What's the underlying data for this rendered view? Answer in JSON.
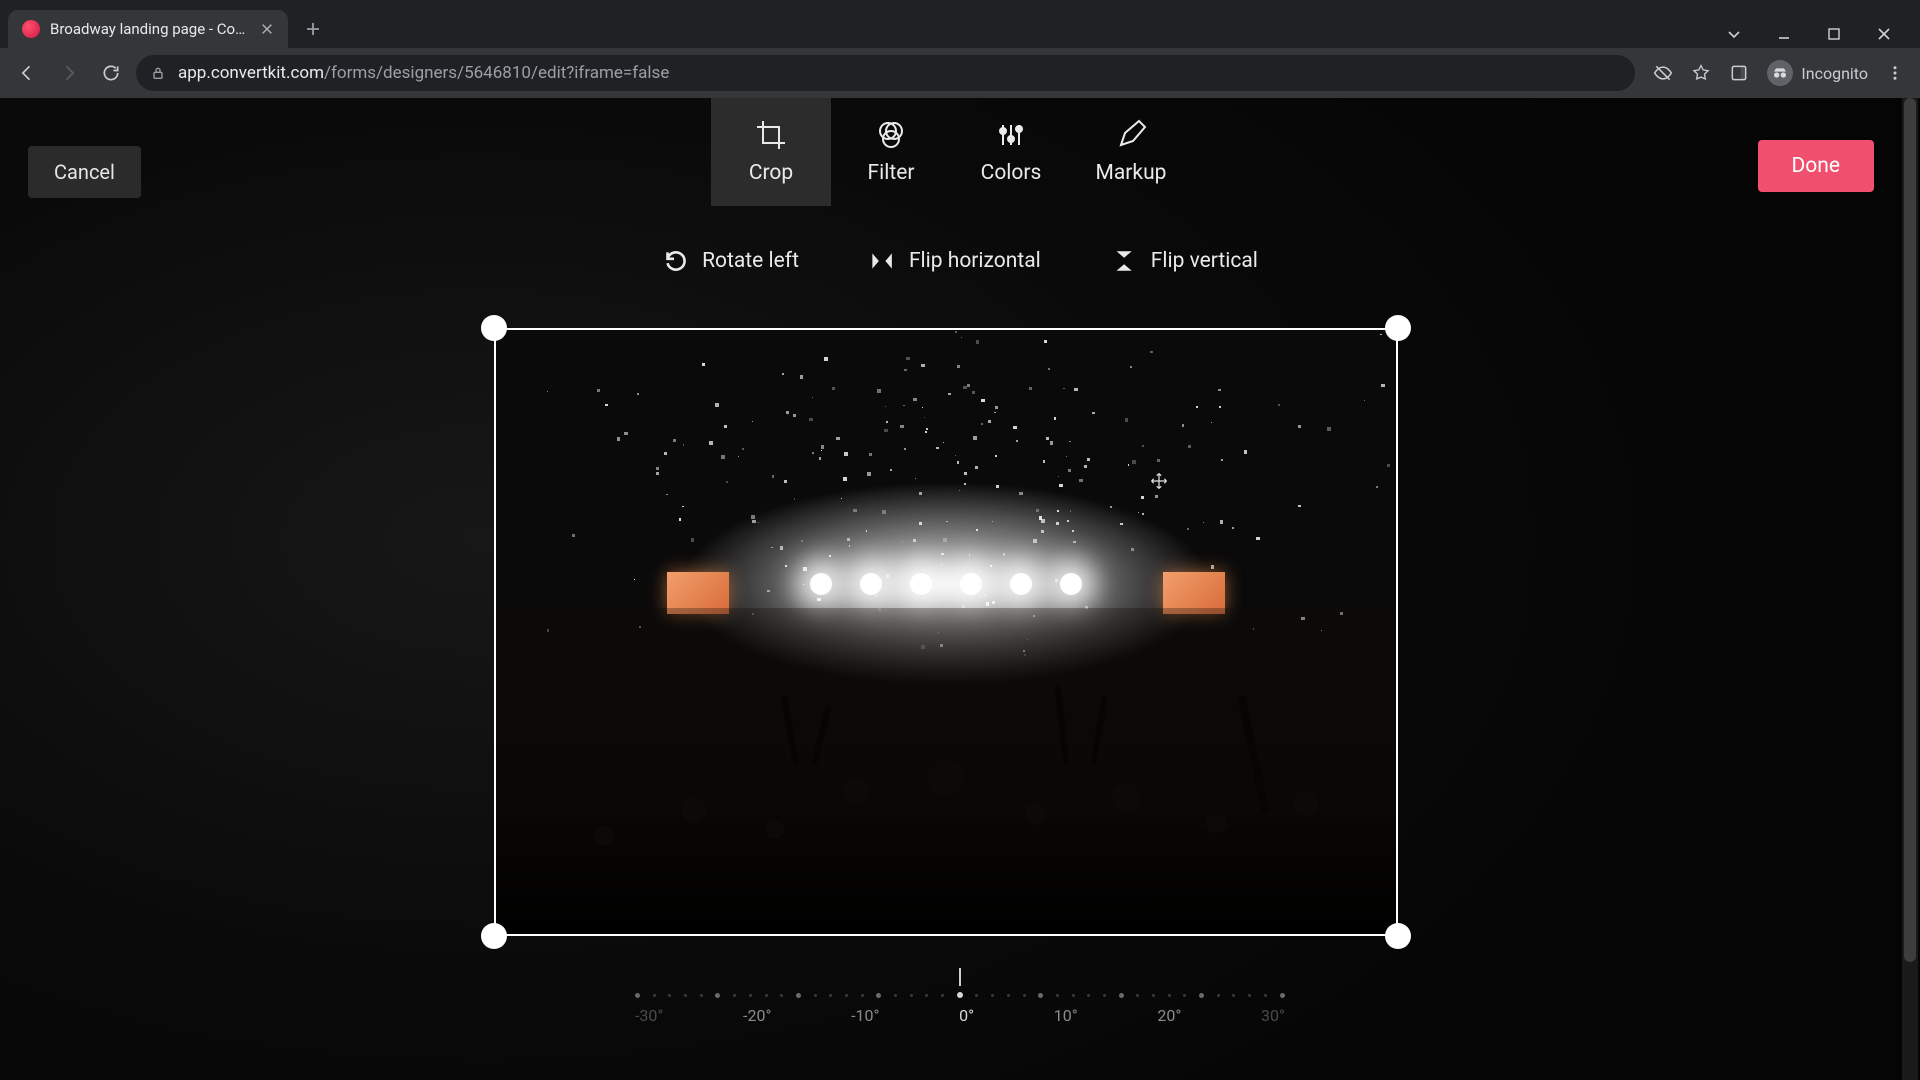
{
  "browser": {
    "tab_title": "Broadway landing page - Conver",
    "url_host": "app.convertkit.com",
    "url_path": "/forms/designers/5646810/edit?iframe=false",
    "incognito_label": "Incognito"
  },
  "editor": {
    "cancel_label": "Cancel",
    "done_label": "Done",
    "accent_color": "#f0506e",
    "modes": {
      "crop": "Crop",
      "filter": "Filter",
      "colors": "Colors",
      "markup": "Markup"
    },
    "active_mode": "crop",
    "crop_tools": {
      "rotate_left": "Rotate left",
      "flip_h": "Flip horizontal",
      "flip_v": "Flip vertical"
    },
    "rotation": {
      "labels": [
        "-30°",
        "-20°",
        "-10°",
        "0°",
        "10°",
        "20°",
        "30°"
      ],
      "current": "0°"
    }
  }
}
